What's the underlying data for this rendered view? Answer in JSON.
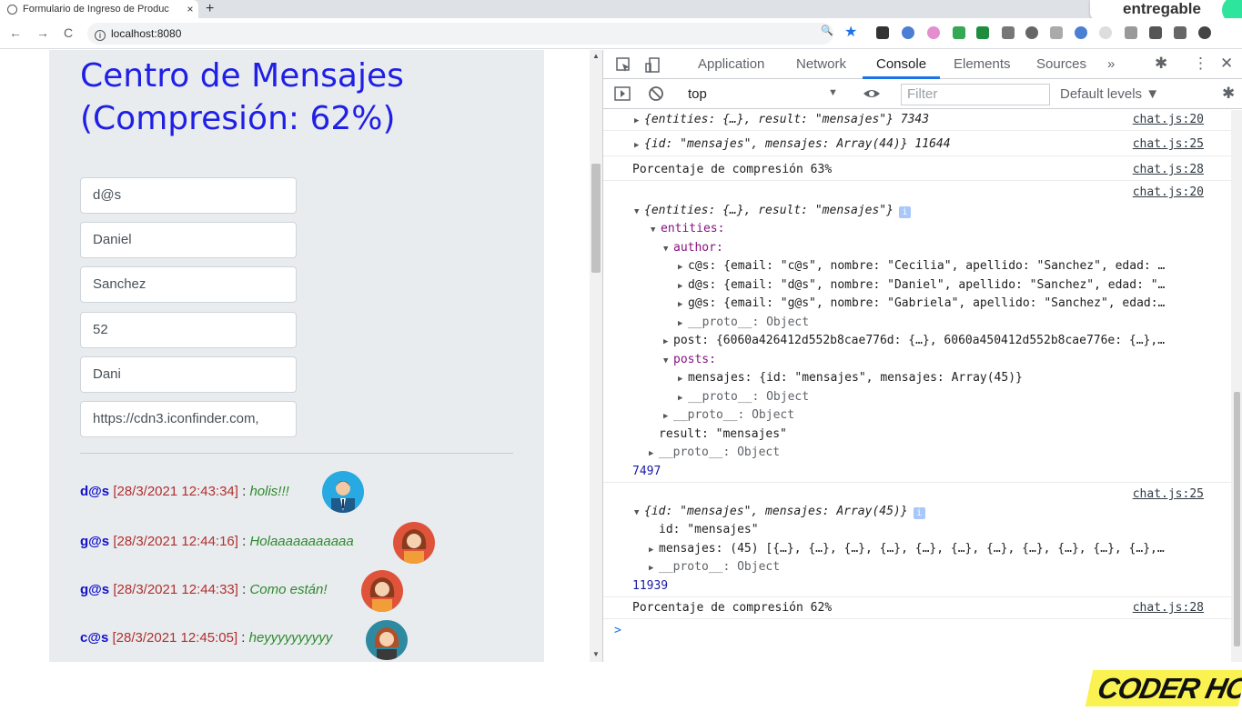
{
  "browser": {
    "tab_title": "Formulario de Ingreso de Produc",
    "tab_close": "×",
    "new_tab": "+",
    "url": "localhost:8080",
    "badge": "entregable",
    "nav_back": "←",
    "nav_forward": "→",
    "nav_reload": "C",
    "info_glyph": "i",
    "zoom_icon": "🔍",
    "star_icon": "★"
  },
  "page": {
    "heading_line1": "Centro de Mensajes",
    "heading_line2": "(Compresión: 62%)",
    "fields": [
      "d@s",
      "Daniel",
      "Sanchez",
      "52",
      "Dani",
      "https://cdn3.iconfinder.com,"
    ],
    "messages": [
      {
        "author": "d@s",
        "date": "[28/3/2021 12:43:34]",
        "sep": " : ",
        "text": "holis!!!",
        "avatar": "male"
      },
      {
        "author": "g@s",
        "date": "[28/3/2021 12:44:16]",
        "sep": " : ",
        "text": "Holaaaaaaaaaaa",
        "avatar": "female"
      },
      {
        "author": "g@s",
        "date": "[28/3/2021 12:44:33]",
        "sep": " : ",
        "text": "Como están!",
        "avatar": "female"
      },
      {
        "author": "c@s",
        "date": "[28/3/2021 12:45:05]",
        "sep": " : ",
        "text": "heyyyyyyyyyy",
        "avatar": "female2"
      }
    ]
  },
  "devtools": {
    "tabs": [
      "Application",
      "Network",
      "Console",
      "Elements",
      "Sources",
      "»"
    ],
    "active_tab": "Console",
    "context": "top",
    "filter_placeholder": "Filter",
    "levels": "Default levels ▼",
    "lines": [
      {
        "t": "{entities: {…}, result: \"mensajes\"} 7343",
        "src": "chat.js:20"
      },
      {
        "t": "{id: \"mensajes\", mensajes: Array(44)} 11644",
        "src": "chat.js:25"
      },
      {
        "t": "Porcentaje de compresión 63%",
        "src": "chat.js:28"
      },
      {
        "src": "chat.js:20"
      },
      {
        "t": "{entities: {…}, result: \"mensajes\"}"
      },
      {
        "t": "entities:"
      },
      {
        "t": "author:"
      },
      {
        "t": "c@s: {email: \"c@s\", nombre: \"Cecilia\", apellido: \"Sanchez\", edad: …"
      },
      {
        "t": "d@s: {email: \"d@s\", nombre: \"Daniel\", apellido: \"Sanchez\", edad: \"…"
      },
      {
        "t": "g@s: {email: \"g@s\", nombre: \"Gabriela\", apellido: \"Sanchez\", edad:…"
      },
      {
        "t": "__proto__: Object"
      },
      {
        "t": "post: {6060a426412d552b8cae776d: {…}, 6060a450412d552b8cae776e: {…},…"
      },
      {
        "t": "posts:"
      },
      {
        "t": "mensajes: {id: \"mensajes\", mensajes: Array(45)}"
      },
      {
        "t": "__proto__: Object"
      },
      {
        "t": "__proto__: Object"
      },
      {
        "t": "result: \"mensajes\""
      },
      {
        "t": "__proto__: Object"
      },
      {
        "t": "7497"
      },
      {
        "src": "chat.js:25"
      },
      {
        "t": "{id: \"mensajes\", mensajes: Array(45)}"
      },
      {
        "t": "id: \"mensajes\""
      },
      {
        "t": "mensajes: (45) [{…}, {…}, {…}, {…}, {…}, {…}, {…}, {…}, {…}, {…}, {…},…"
      },
      {
        "t": "__proto__: Object"
      },
      {
        "t": "11939"
      },
      {
        "t": "Porcentaje de compresión 62%",
        "src": "chat.js:28"
      },
      {
        "t": ">"
      }
    ]
  },
  "logo": "CODER HOUSE",
  "colors": {
    "heading": "#1f1fe6",
    "author": "#1010c8",
    "date": "#b03030",
    "message": "#2c8a2c",
    "console_key": "#881280",
    "console_string": "#c41a16",
    "console_number": "#1a1aa6",
    "logo_bg": "#f9f250"
  }
}
